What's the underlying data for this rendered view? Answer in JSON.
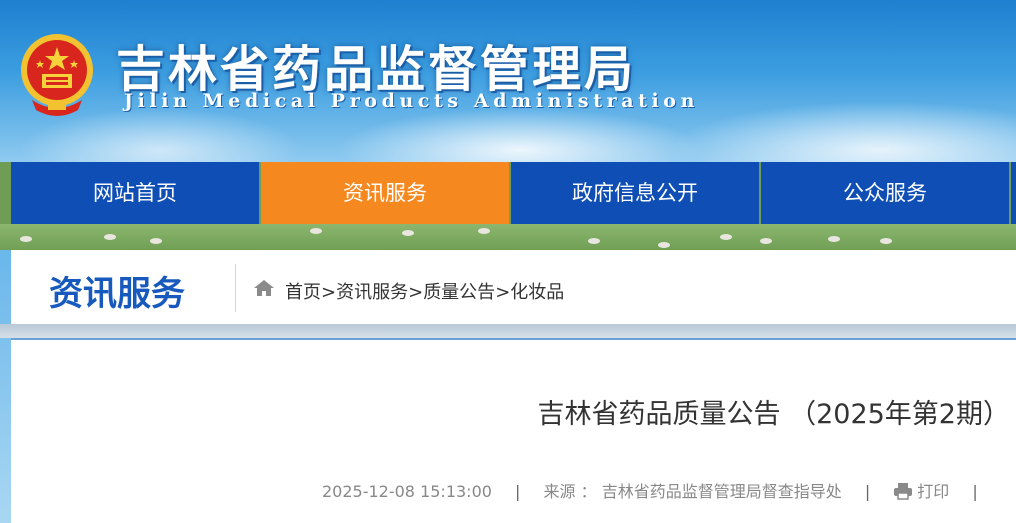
{
  "site": {
    "title": "吉林省药品监督管理局",
    "subtitle": "Jilin Medical Products Administration",
    "emblem_icon": "national-emblem-icon"
  },
  "nav": {
    "items": [
      {
        "label": "网站首页",
        "active": false
      },
      {
        "label": "资讯服务",
        "active": true
      },
      {
        "label": "政府信息公开",
        "active": false
      },
      {
        "label": "公众服务",
        "active": false
      }
    ],
    "active_color": "#f5881f",
    "default_color": "#0f4fb5"
  },
  "section": {
    "title": "资讯服务",
    "home_icon": "home-icon",
    "breadcrumb": [
      "首页",
      "资讯服务",
      "质量公告",
      "化妆品"
    ],
    "separator": ">"
  },
  "article": {
    "title": "吉林省药品质量公告 （2025年第2期）",
    "date": "2025-12-08 15:13:00",
    "source_label": "来源 ：",
    "source": "吉林省药品监督管理局督查指导处",
    "print_label": "打印",
    "print_icon": "printer-icon",
    "meta_separator": "|"
  }
}
